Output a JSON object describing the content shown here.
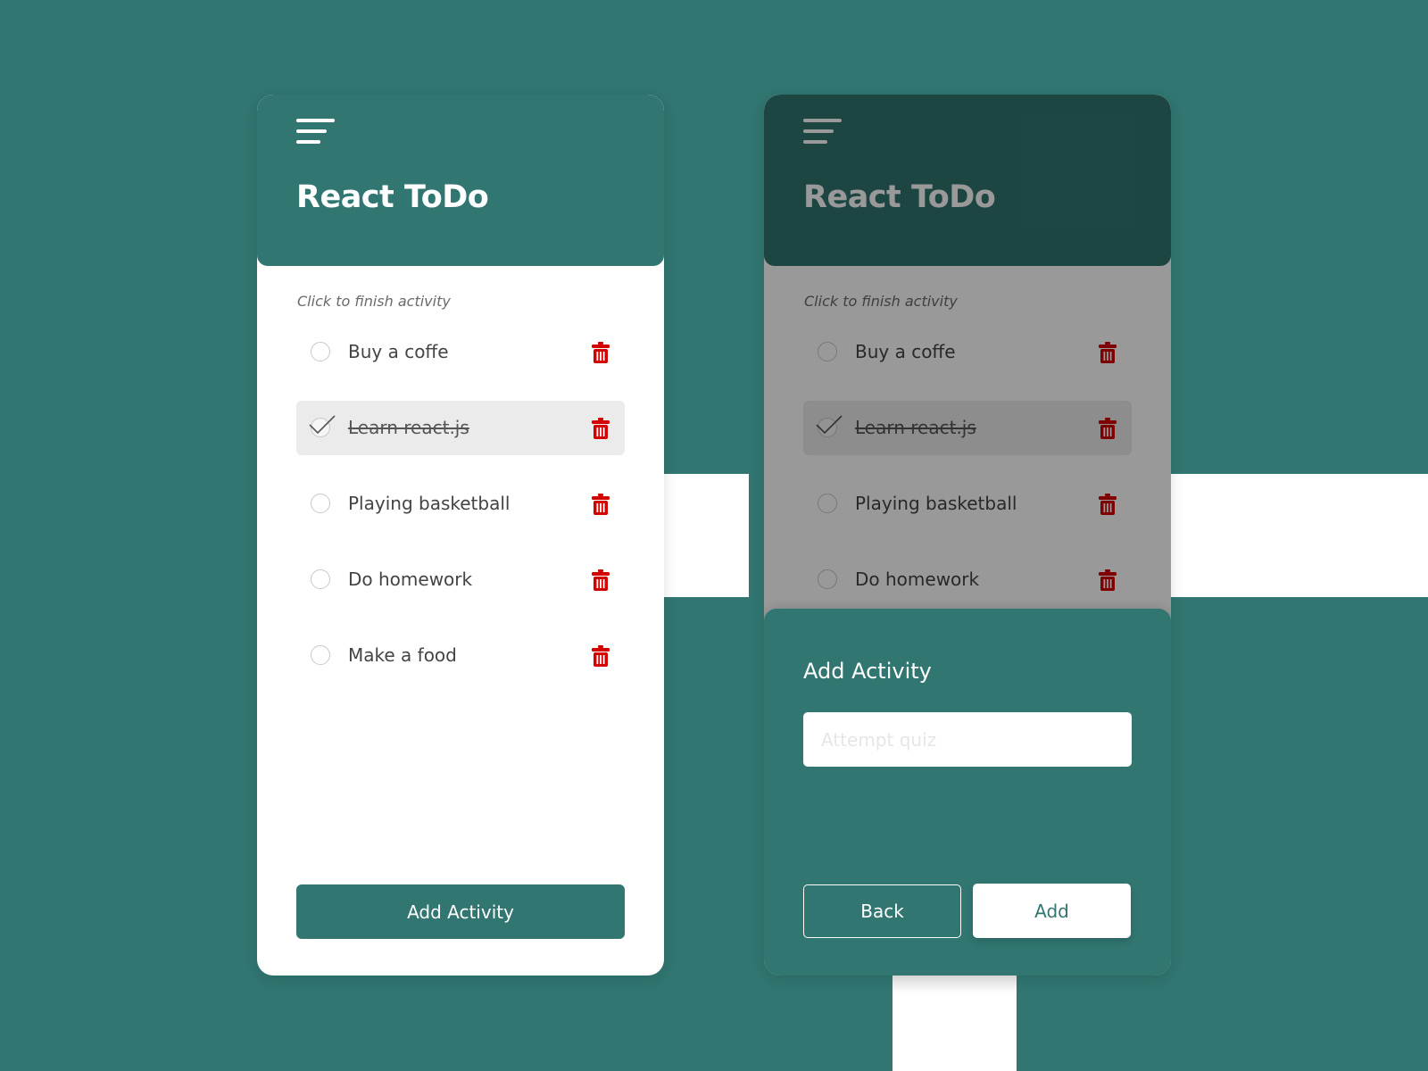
{
  "colors": {
    "background": "#317671",
    "primary": "#317671",
    "delete": "#d40000",
    "card": "#ffffff",
    "done_row": "#ebebeb"
  },
  "app": {
    "title": "React ToDo",
    "menu_icon": "hamburger-menu-icon"
  },
  "list": {
    "hint": "Click to finish activity",
    "items": [
      {
        "label": "Buy a coffe",
        "done": false
      },
      {
        "label": "Learn react.js",
        "done": true
      },
      {
        "label": "Playing basketball",
        "done": false
      },
      {
        "label": "Do homework",
        "done": false
      },
      {
        "label": "Make a food",
        "done": false
      }
    ],
    "delete_icon": "trash-icon",
    "check_icon": "checkmark-icon"
  },
  "footer": {
    "add_activity_label": "Add Activity"
  },
  "add_sheet": {
    "title": "Add Activity",
    "input_value": "",
    "input_placeholder": "Attempt quiz",
    "back_label": "Back",
    "add_label": "Add"
  }
}
